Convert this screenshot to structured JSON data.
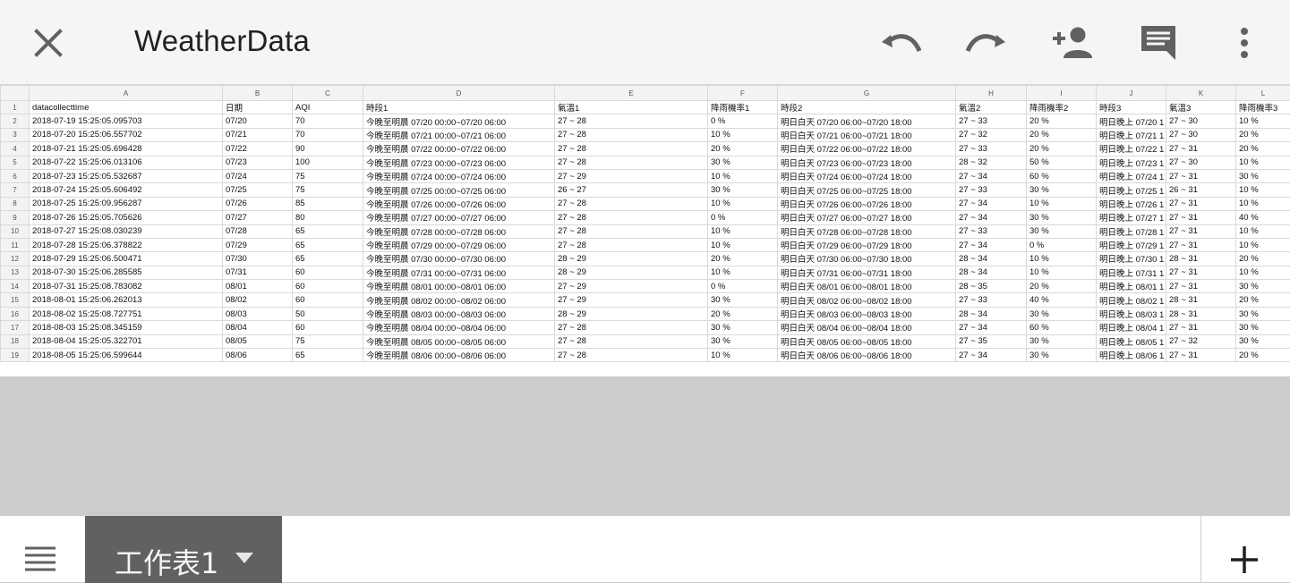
{
  "header": {
    "title": "WeatherData",
    "icons": [
      "close-icon",
      "undo-icon",
      "redo-icon",
      "add-person-icon",
      "comment-icon",
      "more-vert-icon"
    ]
  },
  "grid": {
    "column_letters": [
      "A",
      "B",
      "C",
      "D",
      "E",
      "F",
      "G",
      "H",
      "I",
      "J",
      "K",
      "L"
    ],
    "rows": [
      {
        "n": "1",
        "c": [
          "datacollecttime",
          "日期",
          "AQI",
          "時段1",
          "氣溫1",
          "降雨機率1",
          "時段2",
          "氣溫2",
          "降雨機率2",
          "時段3",
          "氣溫3",
          "降雨機率3"
        ]
      },
      {
        "n": "2",
        "c": [
          "2018-07-19 15:25:05.095703",
          "07/20",
          "70",
          "今晚至明晨 07/20 00:00~07/20 06:00",
          "27 ~ 28",
          "0 %",
          "明日白天 07/20 06:00~07/20 18:00",
          "27 ~ 33",
          "20 %",
          "明日晚上 07/20 1",
          "27 ~ 30",
          "10 %"
        ]
      },
      {
        "n": "3",
        "c": [
          "2018-07-20 15:25:06.557702",
          "07/21",
          "70",
          "今晚至明晨 07/21 00:00~07/21 06:00",
          "27 ~ 28",
          "10 %",
          "明日白天 07/21 06:00~07/21 18:00",
          "27 ~ 32",
          "20 %",
          "明日晚上 07/21 1",
          "27 ~ 30",
          "20 %"
        ]
      },
      {
        "n": "4",
        "c": [
          "2018-07-21 15:25:05.696428",
          "07/22",
          "90",
          "今晚至明晨 07/22 00:00~07/22 06:00",
          "27 ~ 28",
          "20 %",
          "明日白天 07/22 06:00~07/22 18:00",
          "27 ~ 33",
          "20 %",
          "明日晚上 07/22 1",
          "27 ~ 31",
          "20 %"
        ]
      },
      {
        "n": "5",
        "c": [
          "2018-07-22 15:25:06.013106",
          "07/23",
          "100",
          "今晚至明晨 07/23 00:00~07/23 06:00",
          "27 ~ 28",
          "30 %",
          "明日白天 07/23 06:00~07/23 18:00",
          "28 ~ 32",
          "50 %",
          "明日晚上 07/23 1",
          "27 ~ 30",
          "10 %"
        ]
      },
      {
        "n": "6",
        "c": [
          "2018-07-23 15:25:05.532687",
          "07/24",
          "75",
          "今晚至明晨 07/24 00:00~07/24 06:00",
          "27 ~ 29",
          "10 %",
          "明日白天 07/24 06:00~07/24 18:00",
          "27 ~ 34",
          "60 %",
          "明日晚上 07/24 1",
          "27 ~ 31",
          "30 %"
        ]
      },
      {
        "n": "7",
        "c": [
          "2018-07-24 15:25:05.606492",
          "07/25",
          "75",
          "今晚至明晨 07/25 00:00~07/25 06:00",
          "26 ~ 27",
          "30 %",
          "明日白天 07/25 06:00~07/25 18:00",
          "27 ~ 33",
          "30 %",
          "明日晚上 07/25 1",
          "26 ~ 31",
          "10 %"
        ]
      },
      {
        "n": "8",
        "c": [
          "2018-07-25 15:25:09.956287",
          "07/26",
          "85",
          "今晚至明晨 07/26 00:00~07/26 06:00",
          "27 ~ 28",
          "10 %",
          "明日白天 07/26 06:00~07/26 18:00",
          "27 ~ 34",
          "10 %",
          "明日晚上 07/26 1",
          "27 ~ 31",
          "10 %"
        ]
      },
      {
        "n": "9",
        "c": [
          "2018-07-26 15:25:05.705626",
          "07/27",
          "80",
          "今晚至明晨 07/27 00:00~07/27 06:00",
          "27 ~ 28",
          "0 %",
          "明日白天 07/27 06:00~07/27 18:00",
          "27 ~ 34",
          "30 %",
          "明日晚上 07/27 1",
          "27 ~ 31",
          "40 %"
        ]
      },
      {
        "n": "10",
        "c": [
          "2018-07-27 15:25:08.030239",
          "07/28",
          "65",
          "今晚至明晨 07/28 00:00~07/28 06:00",
          "27 ~ 28",
          "10 %",
          "明日白天 07/28 06:00~07/28 18:00",
          "27 ~ 33",
          "30 %",
          "明日晚上 07/28 1",
          "27 ~ 31",
          "10 %"
        ]
      },
      {
        "n": "11",
        "c": [
          "2018-07-28 15:25:06.378822",
          "07/29",
          "65",
          "今晚至明晨 07/29 00:00~07/29 06:00",
          "27 ~ 28",
          "10 %",
          "明日白天 07/29 06:00~07/29 18:00",
          "27 ~ 34",
          "0 %",
          "明日晚上 07/29 1",
          "27 ~ 31",
          "10 %"
        ]
      },
      {
        "n": "12",
        "c": [
          "2018-07-29 15:25:06.500471",
          "07/30",
          "65",
          "今晚至明晨 07/30 00:00~07/30 06:00",
          "28 ~ 29",
          "20 %",
          "明日白天 07/30 06:00~07/30 18:00",
          "28 ~ 34",
          "10 %",
          "明日晚上 07/30 1",
          "28 ~ 31",
          "20 %"
        ]
      },
      {
        "n": "13",
        "c": [
          "2018-07-30 15:25:06.285585",
          "07/31",
          "60",
          "今晚至明晨 07/31 00:00~07/31 06:00",
          "28 ~ 29",
          "10 %",
          "明日白天 07/31 06:00~07/31 18:00",
          "28 ~ 34",
          "10 %",
          "明日晚上 07/31 1",
          "27 ~ 31",
          "10 %"
        ]
      },
      {
        "n": "14",
        "c": [
          "2018-07-31 15:25:08.783082",
          "08/01",
          "60",
          "今晚至明晨 08/01 00:00~08/01 06:00",
          "27 ~ 29",
          "0 %",
          "明日白天 08/01 06:00~08/01 18:00",
          "28 ~ 35",
          "20 %",
          "明日晚上 08/01 1",
          "27 ~ 31",
          "30 %"
        ]
      },
      {
        "n": "15",
        "c": [
          "2018-08-01 15:25:06.262013",
          "08/02",
          "60",
          "今晚至明晨 08/02 00:00~08/02 06:00",
          "27 ~ 29",
          "30 %",
          "明日白天 08/02 06:00~08/02 18:00",
          "27 ~ 33",
          "40 %",
          "明日晚上 08/02 1",
          "28 ~ 31",
          "20 %"
        ]
      },
      {
        "n": "16",
        "c": [
          "2018-08-02 15:25:08.727751",
          "08/03",
          "50",
          "今晚至明晨 08/03 00:00~08/03 06:00",
          "28 ~ 29",
          "20 %",
          "明日白天 08/03 06:00~08/03 18:00",
          "28 ~ 34",
          "30 %",
          "明日晚上 08/03 1",
          "28 ~ 31",
          "30 %"
        ]
      },
      {
        "n": "17",
        "c": [
          "2018-08-03 15:25:08.345159",
          "08/04",
          "60",
          "今晚至明晨 08/04 00:00~08/04 06:00",
          "27 ~ 28",
          "30 %",
          "明日白天 08/04 06:00~08/04 18:00",
          "27 ~ 34",
          "60 %",
          "明日晚上 08/04 1",
          "27 ~ 31",
          "30 %"
        ]
      },
      {
        "n": "18",
        "c": [
          "2018-08-04 15:25:05.322701",
          "08/05",
          "75",
          "今晚至明晨 08/05 00:00~08/05 06:00",
          "27 ~ 28",
          "30 %",
          "明日白天 08/05 06:00~08/05 18:00",
          "27 ~ 35",
          "30 %",
          "明日晚上 08/05 1",
          "27 ~ 32",
          "30 %"
        ]
      },
      {
        "n": "19",
        "c": [
          "2018-08-05 15:25:06.599644",
          "08/06",
          "65",
          "今晚至明晨 08/06 00:00~08/06 06:00",
          "27 ~ 28",
          "10 %",
          "明日白天 08/06 06:00~08/06 18:00",
          "27 ~ 34",
          "30 %",
          "明日晚上 08/06 1",
          "27 ~ 31",
          "20 %"
        ]
      }
    ]
  },
  "footer": {
    "active_sheet": "工作表1",
    "icons": [
      "sheet-list-icon",
      "dropdown-caret-icon",
      "add-icon"
    ]
  }
}
